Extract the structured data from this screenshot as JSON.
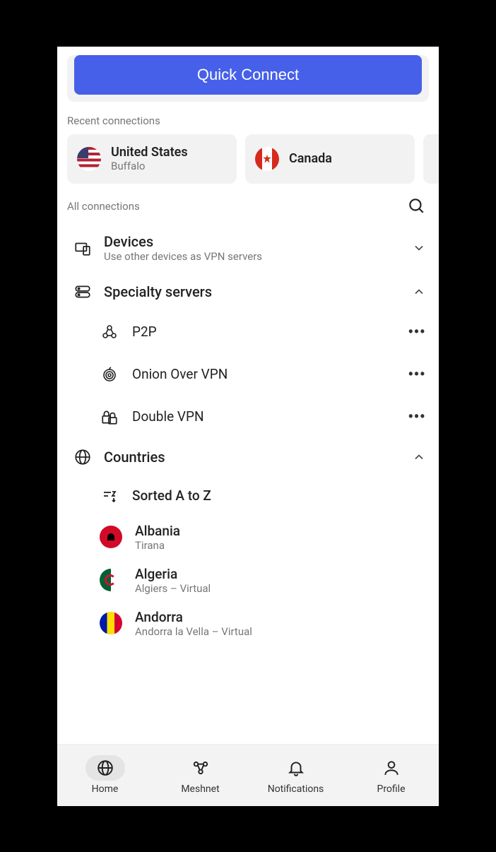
{
  "quick_connect": {
    "label": "Quick Connect"
  },
  "recent": {
    "label": "Recent connections",
    "items": [
      {
        "country": "United States",
        "city": "Buffalo",
        "flag": "us"
      },
      {
        "country": "Canada",
        "city": "",
        "flag": "ca"
      }
    ]
  },
  "all_connections": {
    "label": "All connections"
  },
  "devices": {
    "title": "Devices",
    "subtitle": "Use other devices as VPN servers"
  },
  "specialty": {
    "title": "Specialty servers",
    "items": [
      {
        "label": "P2P"
      },
      {
        "label": "Onion Over VPN"
      },
      {
        "label": "Double VPN"
      }
    ]
  },
  "countries": {
    "title": "Countries",
    "sort_label": "Sorted A to Z",
    "items": [
      {
        "name": "Albania",
        "city": "Tirana",
        "flag": "al"
      },
      {
        "name": "Algeria",
        "city": "Algiers – Virtual",
        "flag": "dz"
      },
      {
        "name": "Andorra",
        "city": "Andorra la Vella – Virtual",
        "flag": "ad"
      }
    ]
  },
  "nav": {
    "items": [
      {
        "label": "Home"
      },
      {
        "label": "Meshnet"
      },
      {
        "label": "Notifications"
      },
      {
        "label": "Profile"
      }
    ]
  }
}
